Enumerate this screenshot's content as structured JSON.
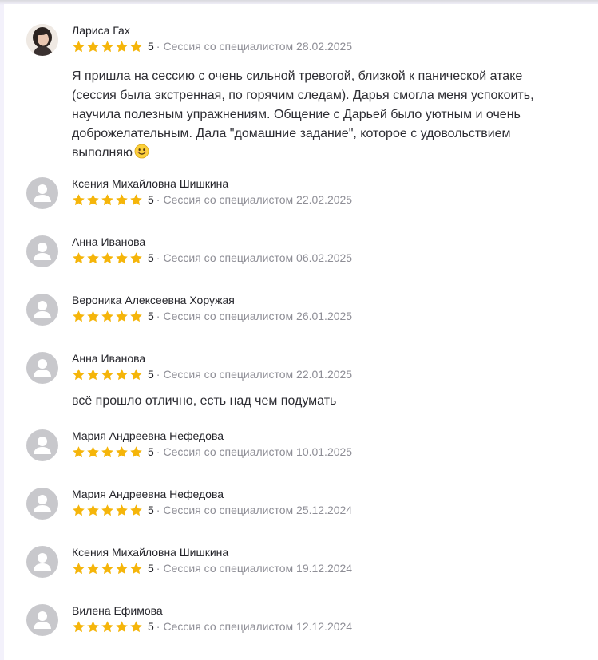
{
  "reviews": [
    {
      "name": "Лариса Гах",
      "rating": "5",
      "stars": 5,
      "session": "Сессия со специалистом 28.02.2025",
      "avatar": "photo-avatar",
      "text_lines": [
        "Я пришла на сессию с очень сильной тревогой, близкой к панической атаке",
        "(сессия была экстренная, по горячим следам). Дарья смогла меня успокоить,",
        "научила полезным упражнениям. Общение с Дарьей было уютным и очень",
        "доброжелательным. Дала \"домашние задание\", которое с удовольствием",
        "выполняю"
      ],
      "emoji": "smiling-face-emoji"
    },
    {
      "name": "Ксения Михайловна Шишкина",
      "rating": "5",
      "stars": 5,
      "session": "Сессия со специалистом 22.02.2025"
    },
    {
      "name": "Анна Иванова",
      "rating": "5",
      "stars": 5,
      "session": "Сессия со специалистом 06.02.2025"
    },
    {
      "name": "Вероника Алексеевна Хоружая",
      "rating": "5",
      "stars": 5,
      "session": "Сессия со специалистом 26.01.2025"
    },
    {
      "name": "Анна Иванова",
      "rating": "5",
      "stars": 5,
      "session": "Сессия со специалистом 22.01.2025",
      "text": "всё прошло отлично, есть над чем подумать"
    },
    {
      "name": "Мария Андреевна Нефедова",
      "rating": "5",
      "stars": 5,
      "session": "Сессия со специалистом 10.01.2025"
    },
    {
      "name": "Мария Андреевна Нефедова",
      "rating": "5",
      "stars": 5,
      "session": "Сессия со специалистом 25.12.2024"
    },
    {
      "name": "Ксения Михайловна Шишкина",
      "rating": "5",
      "stars": 5,
      "session": "Сессия со специалистом 19.12.2024"
    },
    {
      "name": "Вилена Ефимова",
      "rating": "5",
      "stars": 5,
      "session": "Сессия со специалистом 12.12.2024"
    }
  ],
  "separator": "·",
  "colors": {
    "star": "#f5b50a",
    "muted": "#8e8e96",
    "avatar_placeholder": "#c8c8cc"
  },
  "icons": {
    "star": "star-icon",
    "placeholder_avatar": "user-silhouette-icon"
  }
}
